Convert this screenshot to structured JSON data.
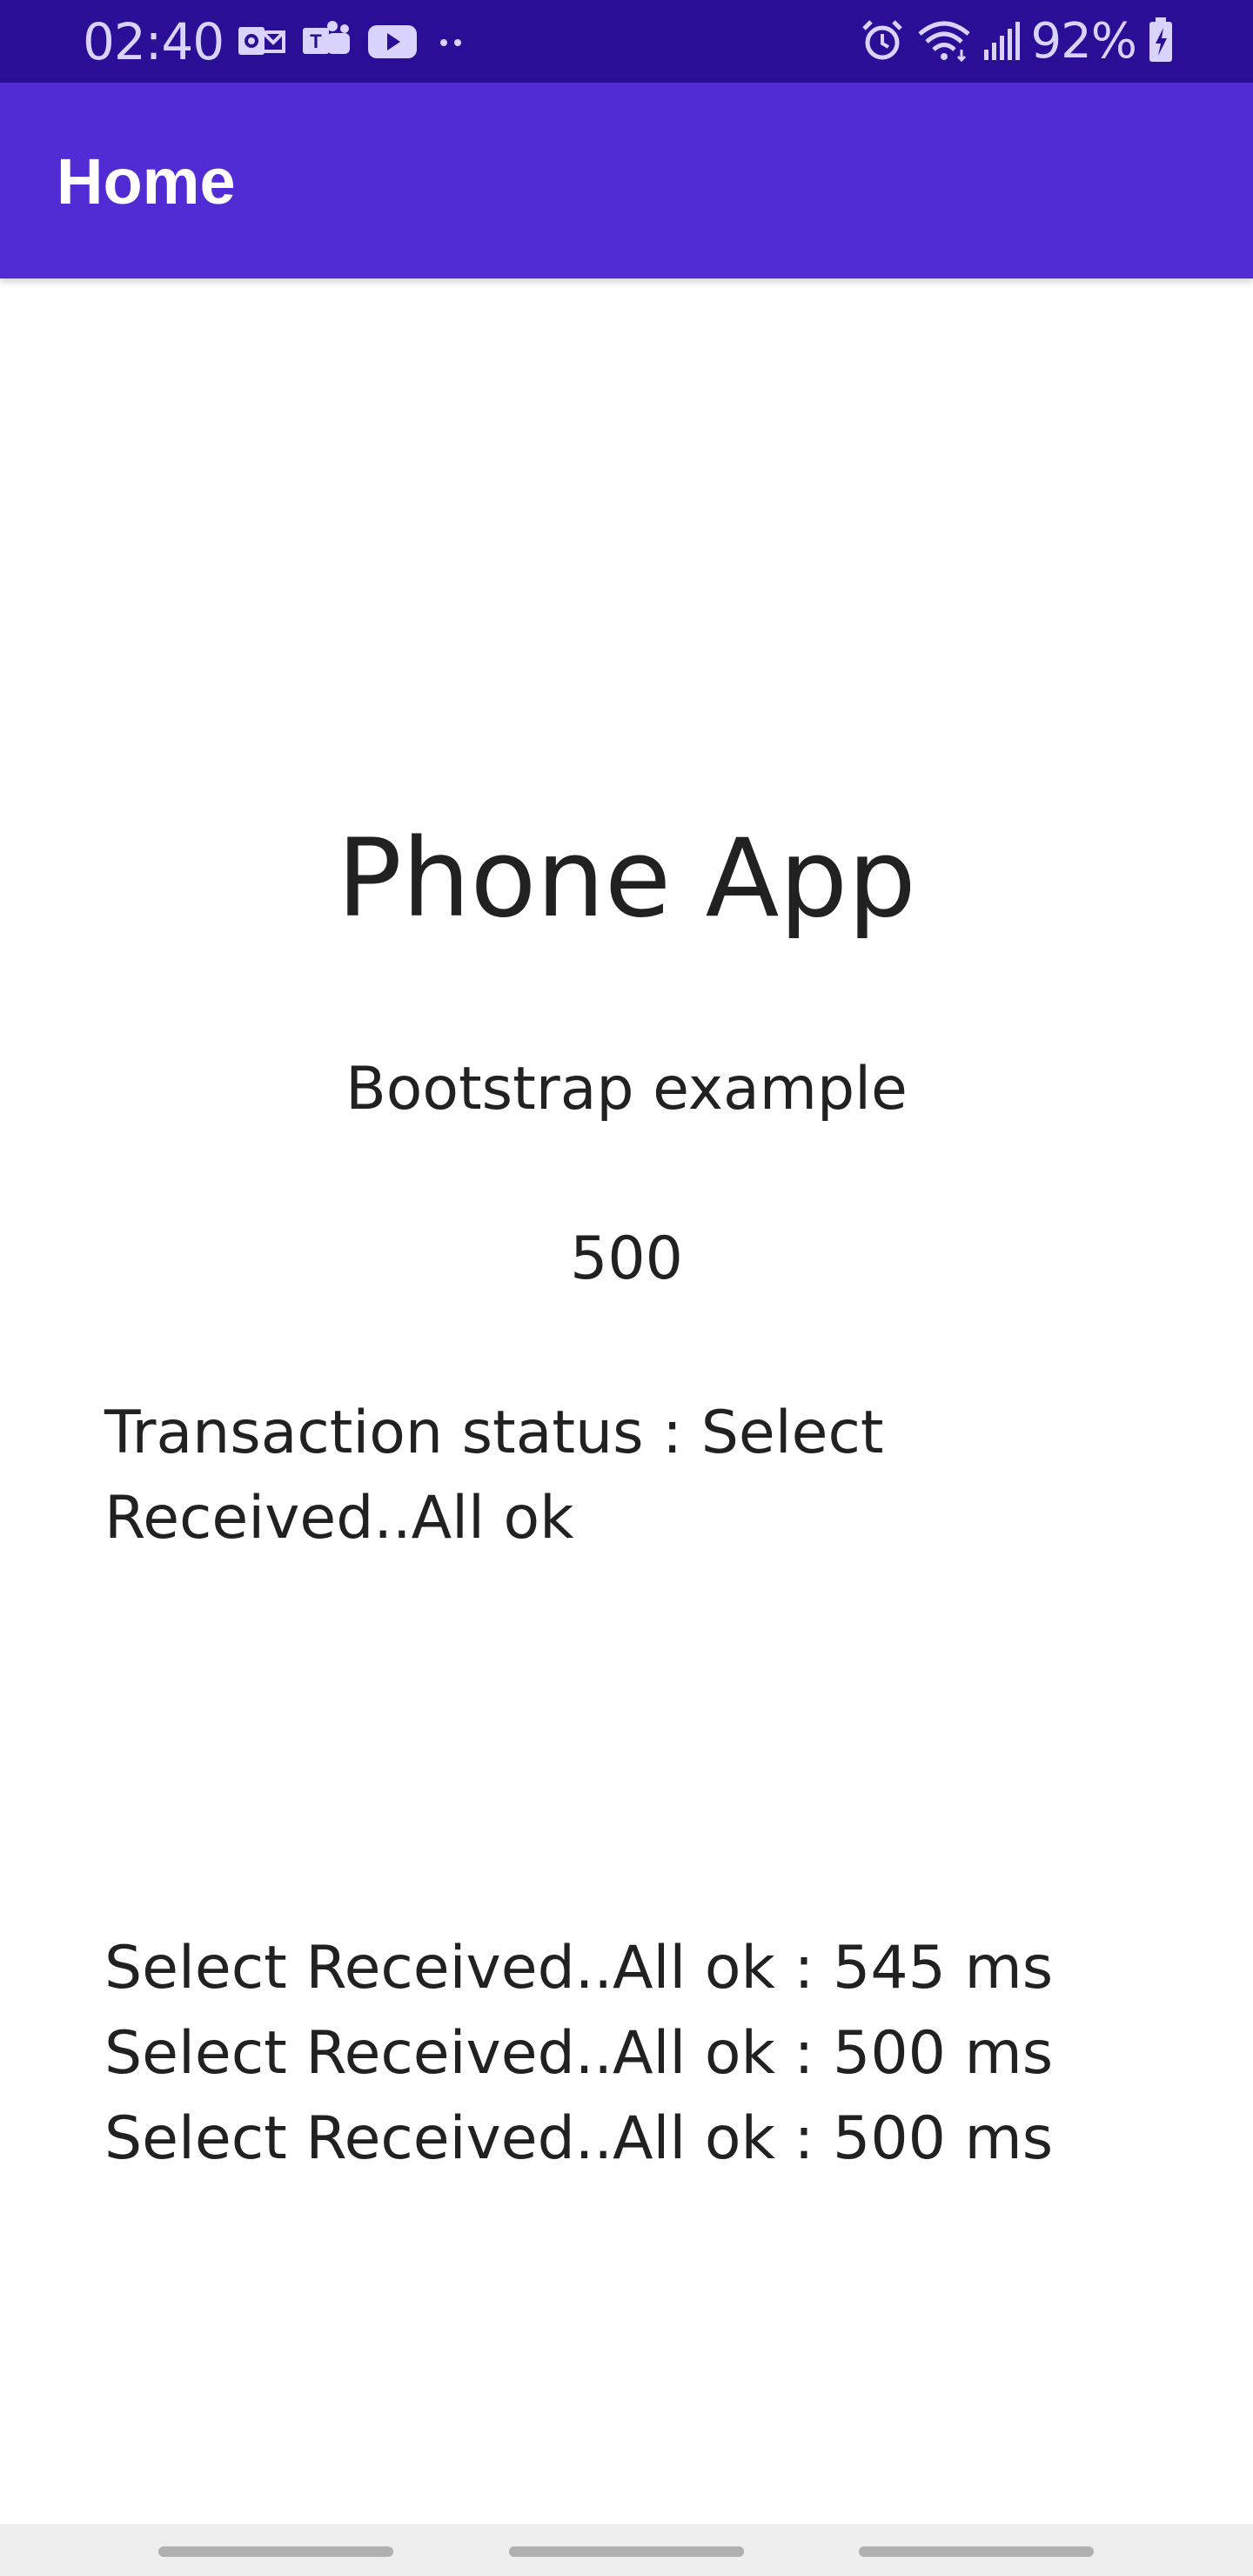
{
  "status_bar": {
    "time": "02:40",
    "battery": "92%",
    "bg_color": "#2a0f96",
    "icons_left": [
      "outlook-icon",
      "teams-icon",
      "youtube-icon",
      "more-dots-icon"
    ],
    "icons_right": [
      "alarm-icon",
      "wifi-icon",
      "signal-icon",
      "battery-charging-icon"
    ]
  },
  "app_bar": {
    "title": "Home",
    "bg_color": "#512bd4"
  },
  "main": {
    "title": "Phone App",
    "subtitle": "Bootstrap example",
    "counter": "500",
    "transaction_status": "Transaction status : Select Received..All ok",
    "log": [
      "Select Received..All ok : 545 ms",
      "Select Received..All ok : 500 ms",
      "Select Received..All ok : 500 ms"
    ]
  }
}
